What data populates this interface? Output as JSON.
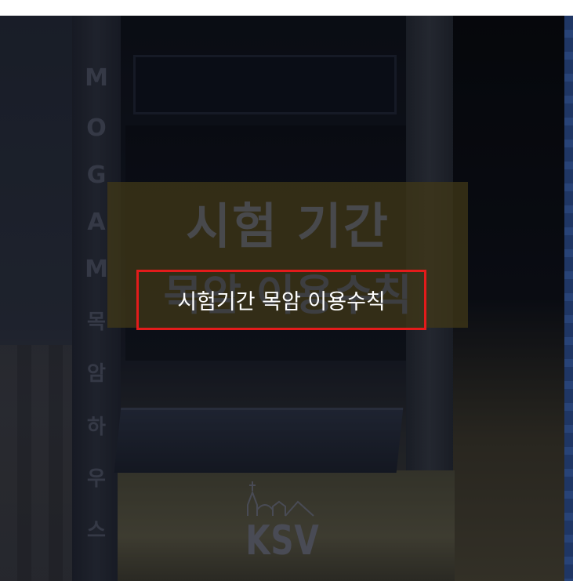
{
  "image": {
    "pillar_letters": [
      "M",
      "O",
      "G",
      "A",
      "M",
      "목",
      "암",
      "하",
      "우",
      "스"
    ],
    "banner_line1": "시험 기간",
    "banner_line2": "목암 이용수칙",
    "logo_text": "KSV"
  },
  "title_overlay": {
    "label": "시험기간 목암 이용수칙"
  },
  "colors": {
    "highlight_border": "#e31b1b",
    "banner": "#5f5019",
    "background": "#1b1f2a"
  }
}
